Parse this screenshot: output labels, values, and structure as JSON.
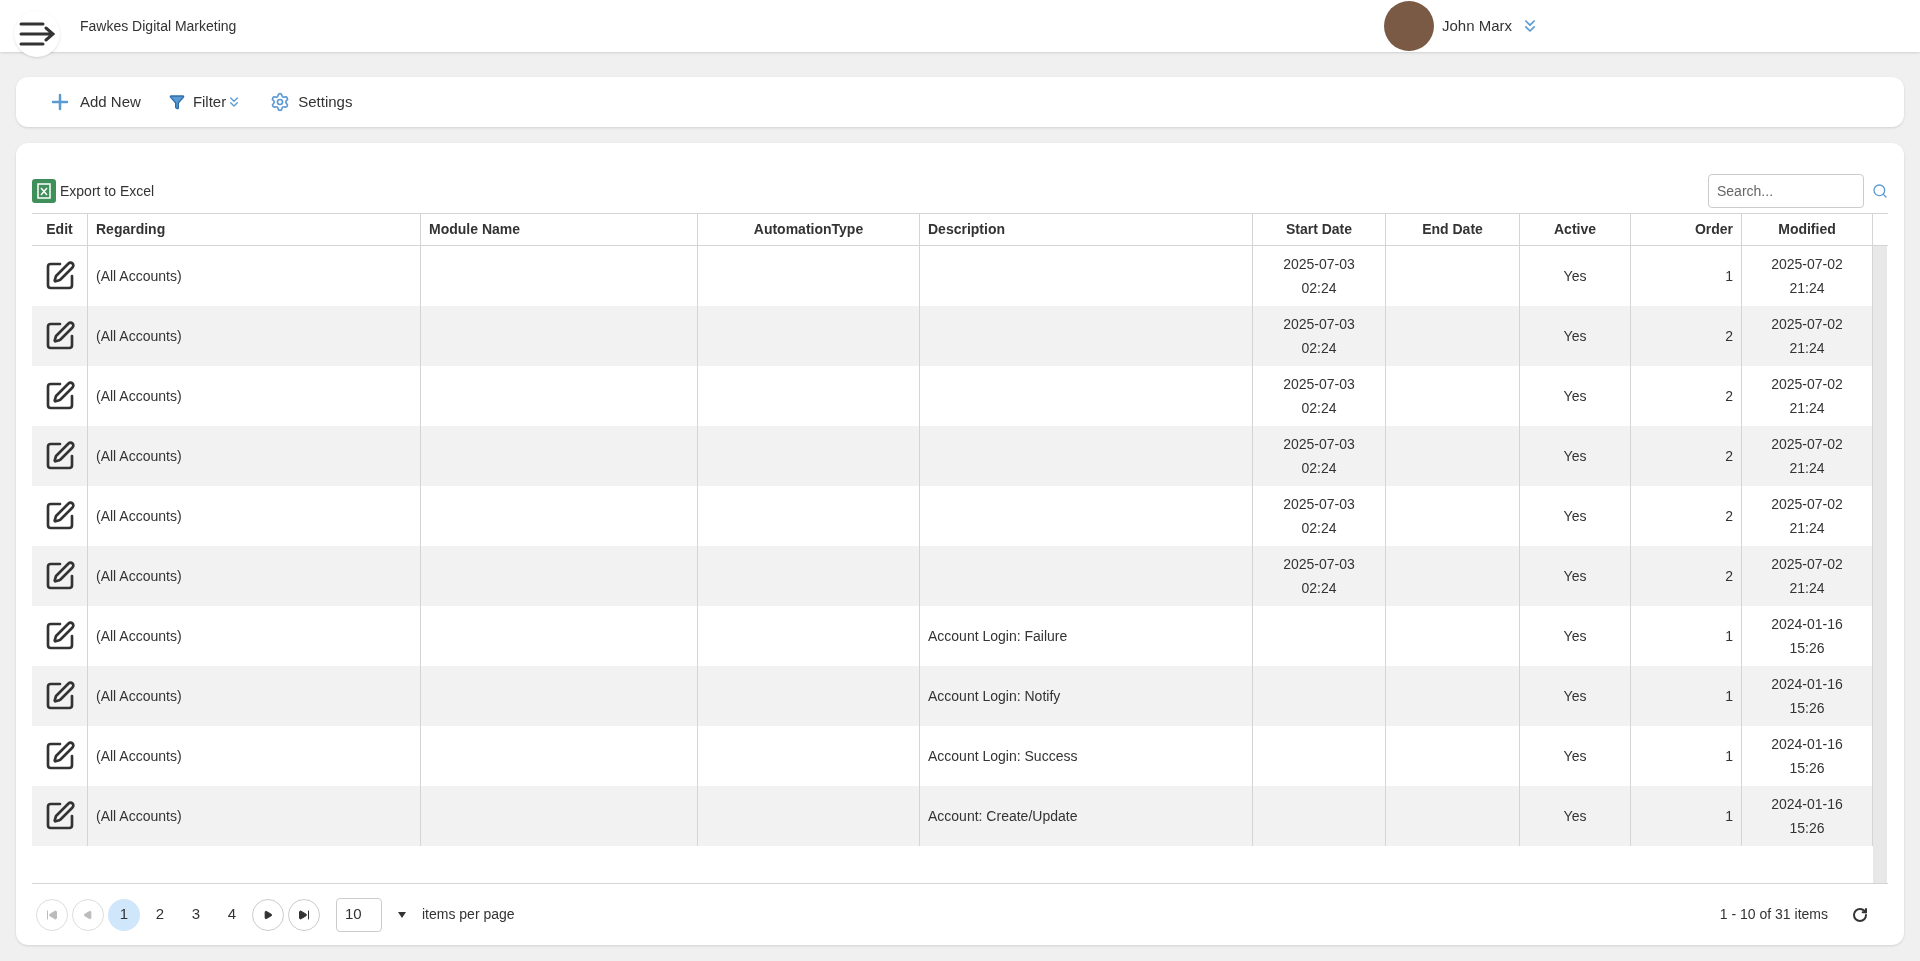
{
  "header": {
    "company": "Fawkes Digital Marketing",
    "user": "John Marx"
  },
  "toolbar": [
    {
      "kind": "add",
      "label": "Add New"
    },
    {
      "kind": "filter",
      "label": "Filter"
    },
    {
      "kind": "settings",
      "label": "Settings"
    }
  ],
  "grid": {
    "export_label": "Export to Excel",
    "search": {
      "placeholder": "Search..."
    },
    "columns": [
      "Edit",
      "Regarding",
      "Module Name",
      "AutomationType",
      "Description",
      "Start Date",
      "End Date",
      "Active",
      "Order",
      "Modified"
    ],
    "rows": [
      {
        "regarding": "(All Accounts)",
        "description": "",
        "start": [
          "2025-07-03",
          "02:24"
        ],
        "active": "Yes",
        "order": "1",
        "modified": [
          "2025-07-02",
          "21:24"
        ]
      },
      {
        "regarding": "(All Accounts)",
        "description": "",
        "start": [
          "2025-07-03",
          "02:24"
        ],
        "active": "Yes",
        "order": "2",
        "modified": [
          "2025-07-02",
          "21:24"
        ]
      },
      {
        "regarding": "(All Accounts)",
        "description": "",
        "start": [
          "2025-07-03",
          "02:24"
        ],
        "active": "Yes",
        "order": "2",
        "modified": [
          "2025-07-02",
          "21:24"
        ]
      },
      {
        "regarding": "(All Accounts)",
        "description": "",
        "start": [
          "2025-07-03",
          "02:24"
        ],
        "active": "Yes",
        "order": "2",
        "modified": [
          "2025-07-02",
          "21:24"
        ]
      },
      {
        "regarding": "(All Accounts)",
        "description": "",
        "start": [
          "2025-07-03",
          "02:24"
        ],
        "active": "Yes",
        "order": "2",
        "modified": [
          "2025-07-02",
          "21:24"
        ]
      },
      {
        "regarding": "(All Accounts)",
        "description": "",
        "start": [
          "2025-07-03",
          "02:24"
        ],
        "active": "Yes",
        "order": "2",
        "modified": [
          "2025-07-02",
          "21:24"
        ]
      },
      {
        "regarding": "(All Accounts)",
        "description": "Account Login: Failure",
        "start": [],
        "active": "Yes",
        "order": "1",
        "modified": [
          "2024-01-16",
          "15:26"
        ]
      },
      {
        "regarding": "(All Accounts)",
        "description": "Account Login: Notify",
        "start": [],
        "active": "Yes",
        "order": "1",
        "modified": [
          "2024-01-16",
          "15:26"
        ]
      },
      {
        "regarding": "(All Accounts)",
        "description": "Account Login: Success",
        "start": [],
        "active": "Yes",
        "order": "1",
        "modified": [
          "2024-01-16",
          "15:26"
        ]
      },
      {
        "regarding": "(All Accounts)",
        "description": "Account: Create/Update",
        "start": [],
        "active": "Yes",
        "order": "1",
        "modified": [
          "2024-01-16",
          "15:26"
        ]
      }
    ]
  },
  "pager": {
    "pages": [
      {
        "label": "1",
        "selected": true
      },
      {
        "label": "2",
        "selected": false
      },
      {
        "label": "3",
        "selected": false
      },
      {
        "label": "4",
        "selected": false
      }
    ],
    "page_size": "10",
    "page_size_label": "items per page",
    "summary": "1 - 10 of 31 items"
  }
}
